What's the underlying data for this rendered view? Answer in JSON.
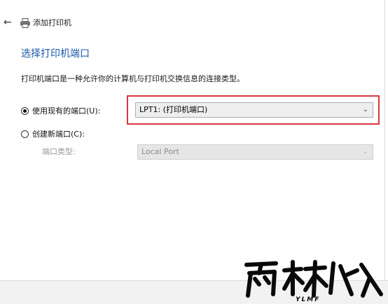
{
  "header": {
    "title": "添加打印机",
    "back_icon": "back-arrow-icon",
    "printer_icon": "printer-icon"
  },
  "page": {
    "heading": "选择打印机端口",
    "description": "打印机端口是一种允许你的计算机与打印机交换信息的连接类型。"
  },
  "options": {
    "existing": {
      "label": "使用现有的端口(U):",
      "selected": true,
      "value": "LPT1: (打印机端口)"
    },
    "create_new": {
      "label": "创建新端口(C):",
      "selected": false,
      "type_label": "端口类型:",
      "type_value": "Local Port"
    }
  },
  "watermark": {
    "text": "YLMF"
  },
  "colors": {
    "accent": "#1b5aa8",
    "highlight": "#d9363e"
  }
}
